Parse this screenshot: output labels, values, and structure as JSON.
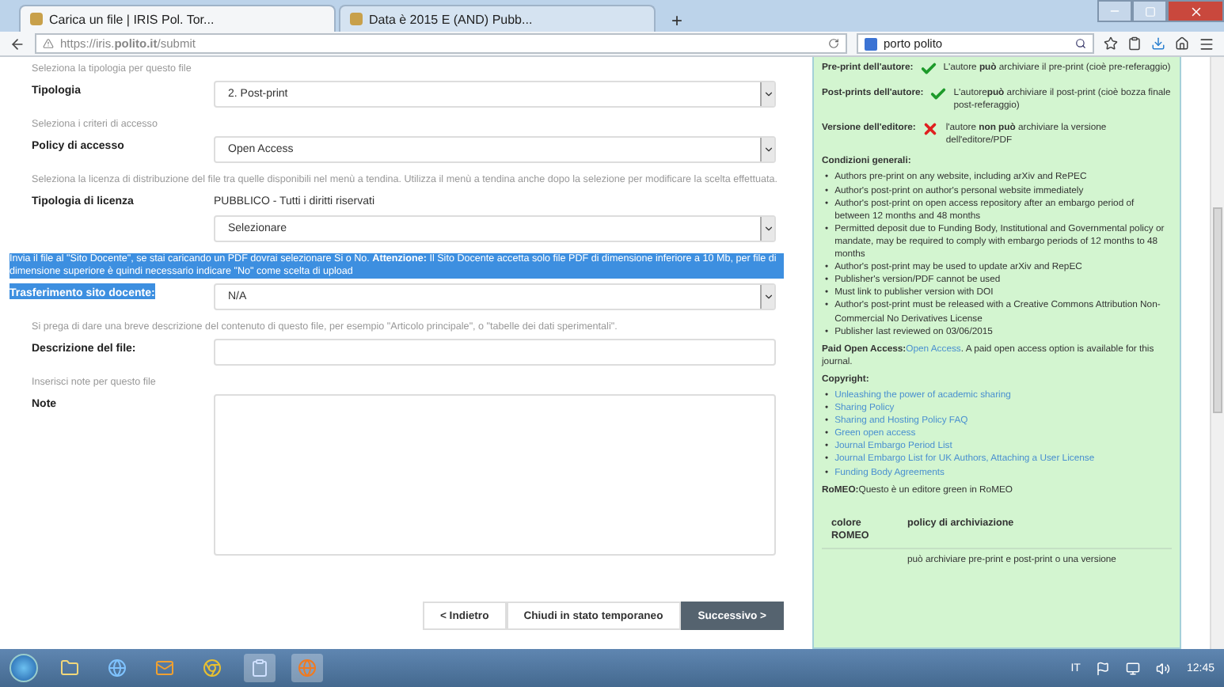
{
  "browser": {
    "tabs": [
      {
        "title": "Carica un file | IRIS Pol. Tor...",
        "selected": true
      },
      {
        "title": "Data è 2015 E (AND) Pubb...",
        "selected": false
      }
    ],
    "new_tab": "+",
    "url": "https://iris.**polito.it**/submit",
    "search": "porto polito"
  },
  "form": {
    "fields": [
      {
        "hint": "Seleziona la tipologia per questo file",
        "label": "Tipologia",
        "kind": "select",
        "value": "2. Post-print"
      },
      {
        "hint": "Seleziona i criteri di accesso",
        "label": "Policy di accesso",
        "kind": "select",
        "value": "Open Access"
      },
      {
        "hint": "Seleziona la licenza di distribuzione del file tra quelle disponibili nel menù a tendina. Utilizza il menù a tendina anche dopo la selezione per modificare la scelta effettuata.",
        "label": "Tipologia di licenza",
        "kind": "static",
        "value": "PUBBLICO - Tutti i diritti riservati"
      },
      {
        "kind": "select",
        "value": "Selezionare"
      },
      {
        "hint": "Invia il file al \"Sito Docente\", se stai caricando un PDF dovrai selezionare Si o No. **Attenzione:** Il Sito Docente accetta solo file PDF di dimensione inferiore a 10 Mb, per file di dimensione superiore è quindi necessario indicare \"No\" come scelta di upload",
        "highlighted": true,
        "label": "Trasferimento sito docente:",
        "kind": "select",
        "value": "N/A"
      },
      {
        "hint": "Si prega di dare una breve descrizione del contenuto di questo file, per esempio \"Articolo principale\", o \"tabelle dei dati sperimentali\".",
        "highlighted": false,
        "label": "Descrizione del file:",
        "kind": "text"
      },
      {
        "hint": "Inserisci note per questo file",
        "highlighted": false,
        "label": "Note",
        "kind": "textarea"
      }
    ],
    "buttons": [
      {
        "label": "< Indietro",
        "kind": "default"
      },
      {
        "label": "Chiudi in stato temporaneo",
        "kind": "default"
      },
      {
        "label": "Successivo >",
        "kind": "primary"
      }
    ]
  },
  "romeo": {
    "permissions": [
      {
        "label": "Pre-print dell'autore:",
        "allowed": true,
        "text": "L'autore **può** archiviare il pre-print (cioè pre-referaggio)"
      },
      {
        "label": "Post-prints dell'autore:",
        "allowed": true,
        "text": "L'autore**può** archiviare il post-print (cioè bozza finale post-referaggio)"
      },
      {
        "label": "Versione dell'editore:",
        "allowed": false,
        "text": "l'autore **non può** archiviare la versione dell'editore/PDF"
      }
    ],
    "conditions_title": "Condizioni generali:",
    "bullet": "•",
    "conditions": [
      "Authors pre-print on any website, including arXiv and RePEC",
      "Author's post-print on author's personal website immediately",
      "Author's post-print on open access repository after an embargo period of between 12 months and 48 months",
      "Permitted deposit due to Funding Body, Institutional and Governmental policy or mandate, may be required to comply with embargo periods of 12 months to 48 months",
      "Author's post-print may be used to update arXiv and RepEC",
      "Publisher's version/PDF cannot be used",
      "Must link to publisher version with DOI",
      "Author's post-print must be released with a Creative Commons Attribution Non-Commercial No Derivatives License",
      "Publisher last reviewed on 03/06/2015"
    ],
    "paid": {
      "label": "Paid Open Access:",
      "link": "Open Access",
      "text": ". A paid open access option is available for this journal."
    },
    "copyright_title": "Copyright:",
    "copyright_links": [
      "Unleashing the power of academic sharing",
      "Sharing Policy",
      "Sharing and Hosting Policy FAQ",
      "Green open access",
      "Journal Embargo Period List",
      "Journal Embargo List for UK Authors, Attaching a User License",
      "Funding Body Agreements"
    ],
    "romeo_line": {
      "label": "RoMEO:",
      "text": "Questo è un editore green in RoMEO"
    },
    "table": {
      "columns": [
        "colore ROMEO",
        "policy di archiviazione"
      ],
      "rows": [
        {
          "column_2": "può archiviare pre-print e post-print o una versione"
        }
      ]
    }
  },
  "taskbar": {
    "language": "IT",
    "time": "12:45"
  }
}
